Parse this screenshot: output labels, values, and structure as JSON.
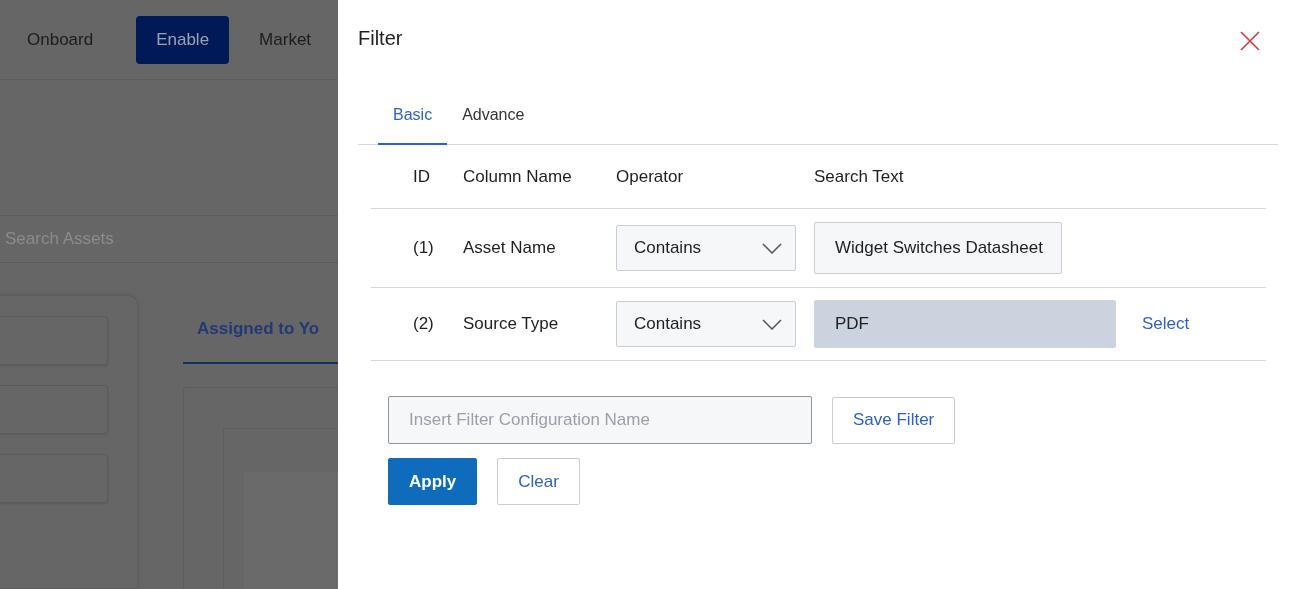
{
  "background": {
    "nav": [
      {
        "label": "Onboard",
        "selected": false
      },
      {
        "label": "Enable",
        "selected": true
      },
      {
        "label": "Market",
        "selected": false
      }
    ],
    "search": {
      "placeholder": "Search Assets"
    },
    "tab": {
      "label": "Assigned to Yo"
    }
  },
  "drawer": {
    "title": "Filter",
    "tabs": [
      {
        "label": "Basic",
        "selected": true
      },
      {
        "label": "Advance",
        "selected": false
      }
    ],
    "columns": [
      "ID",
      "Column Name",
      "Operator",
      "Search Text"
    ],
    "rows": [
      {
        "id": "(1)",
        "column": "Asset Name",
        "operator": "Contains",
        "value": "Widget Switches Datasheet",
        "disabled": false
      },
      {
        "id": "(2)",
        "column": "Source Type",
        "operator": "Contains",
        "value": "PDF",
        "disabled": true,
        "action": "Select"
      }
    ],
    "config": {
      "placeholder": "Insert Filter Configuration Name"
    },
    "buttons": [
      {
        "label": "Save Filter",
        "kind": "outline"
      },
      {
        "label": "Apply",
        "kind": "primary"
      },
      {
        "label": "Clear",
        "kind": "outline"
      }
    ]
  }
}
